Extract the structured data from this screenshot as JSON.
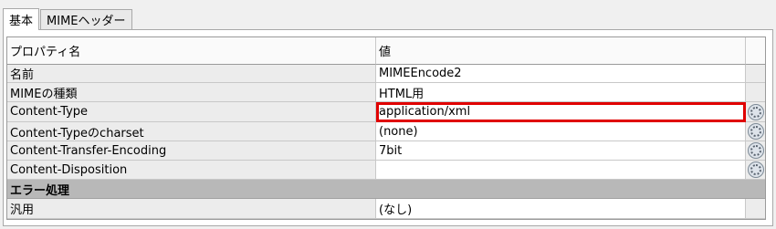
{
  "tabs": [
    {
      "label": "基本",
      "active": true
    },
    {
      "label": "MIMEヘッダー",
      "active": false
    }
  ],
  "table": {
    "headers": {
      "name": "プロパティ名",
      "value": "値"
    },
    "rows": [
      {
        "name": "名前",
        "value": "MIMEEncode2"
      },
      {
        "name": "MIMEの種類",
        "value": "HTML用"
      },
      {
        "name": "Content-Type",
        "value": "application/xml"
      },
      {
        "name": "Content-Typeのcharset",
        "value": "(none)"
      },
      {
        "name": "Content-Transfer-Encoding",
        "value": "7bit"
      },
      {
        "name": "Content-Disposition",
        "value": ""
      }
    ],
    "section": {
      "label": "エラー処理"
    },
    "section_rows": [
      {
        "name": "汎用",
        "value": "(なし)"
      }
    ]
  },
  "colors": {
    "edit_border": "#e00000",
    "section_bg": "#b8b8b8"
  },
  "icons": {
    "row_button": "dots-icon"
  }
}
